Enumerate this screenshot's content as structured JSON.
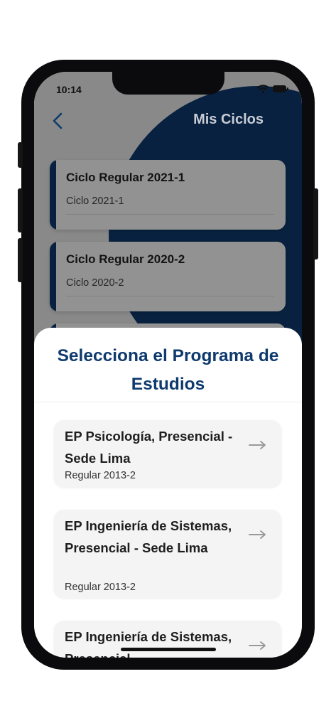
{
  "status_bar": {
    "time": "10:14"
  },
  "header": {
    "title": "Mis Ciclos"
  },
  "cycles": [
    {
      "title": "Ciclo Regular 2021-1",
      "subtitle": "Ciclo 2021-1"
    },
    {
      "title": "Ciclo Regular 2020-2",
      "subtitle": "Ciclo 2020-2"
    }
  ],
  "sheet": {
    "title": "Selecciona el Programa de Estudios",
    "options": [
      {
        "name": "EP Psicología, Presencial - Sede Lima",
        "plan": "Regular 2013-2"
      },
      {
        "name": "EP Ingeniería de Sistemas, Presencial - Sede Lima",
        "plan": "Regular 2013-2"
      },
      {
        "name": "EP Ingeniería de Sistemas, Presencial",
        "plan": ""
      }
    ]
  },
  "colors": {
    "brand": "#0e3a6e",
    "overlay_title": "#c8ccd4",
    "arrow": "#9a9a9a"
  }
}
